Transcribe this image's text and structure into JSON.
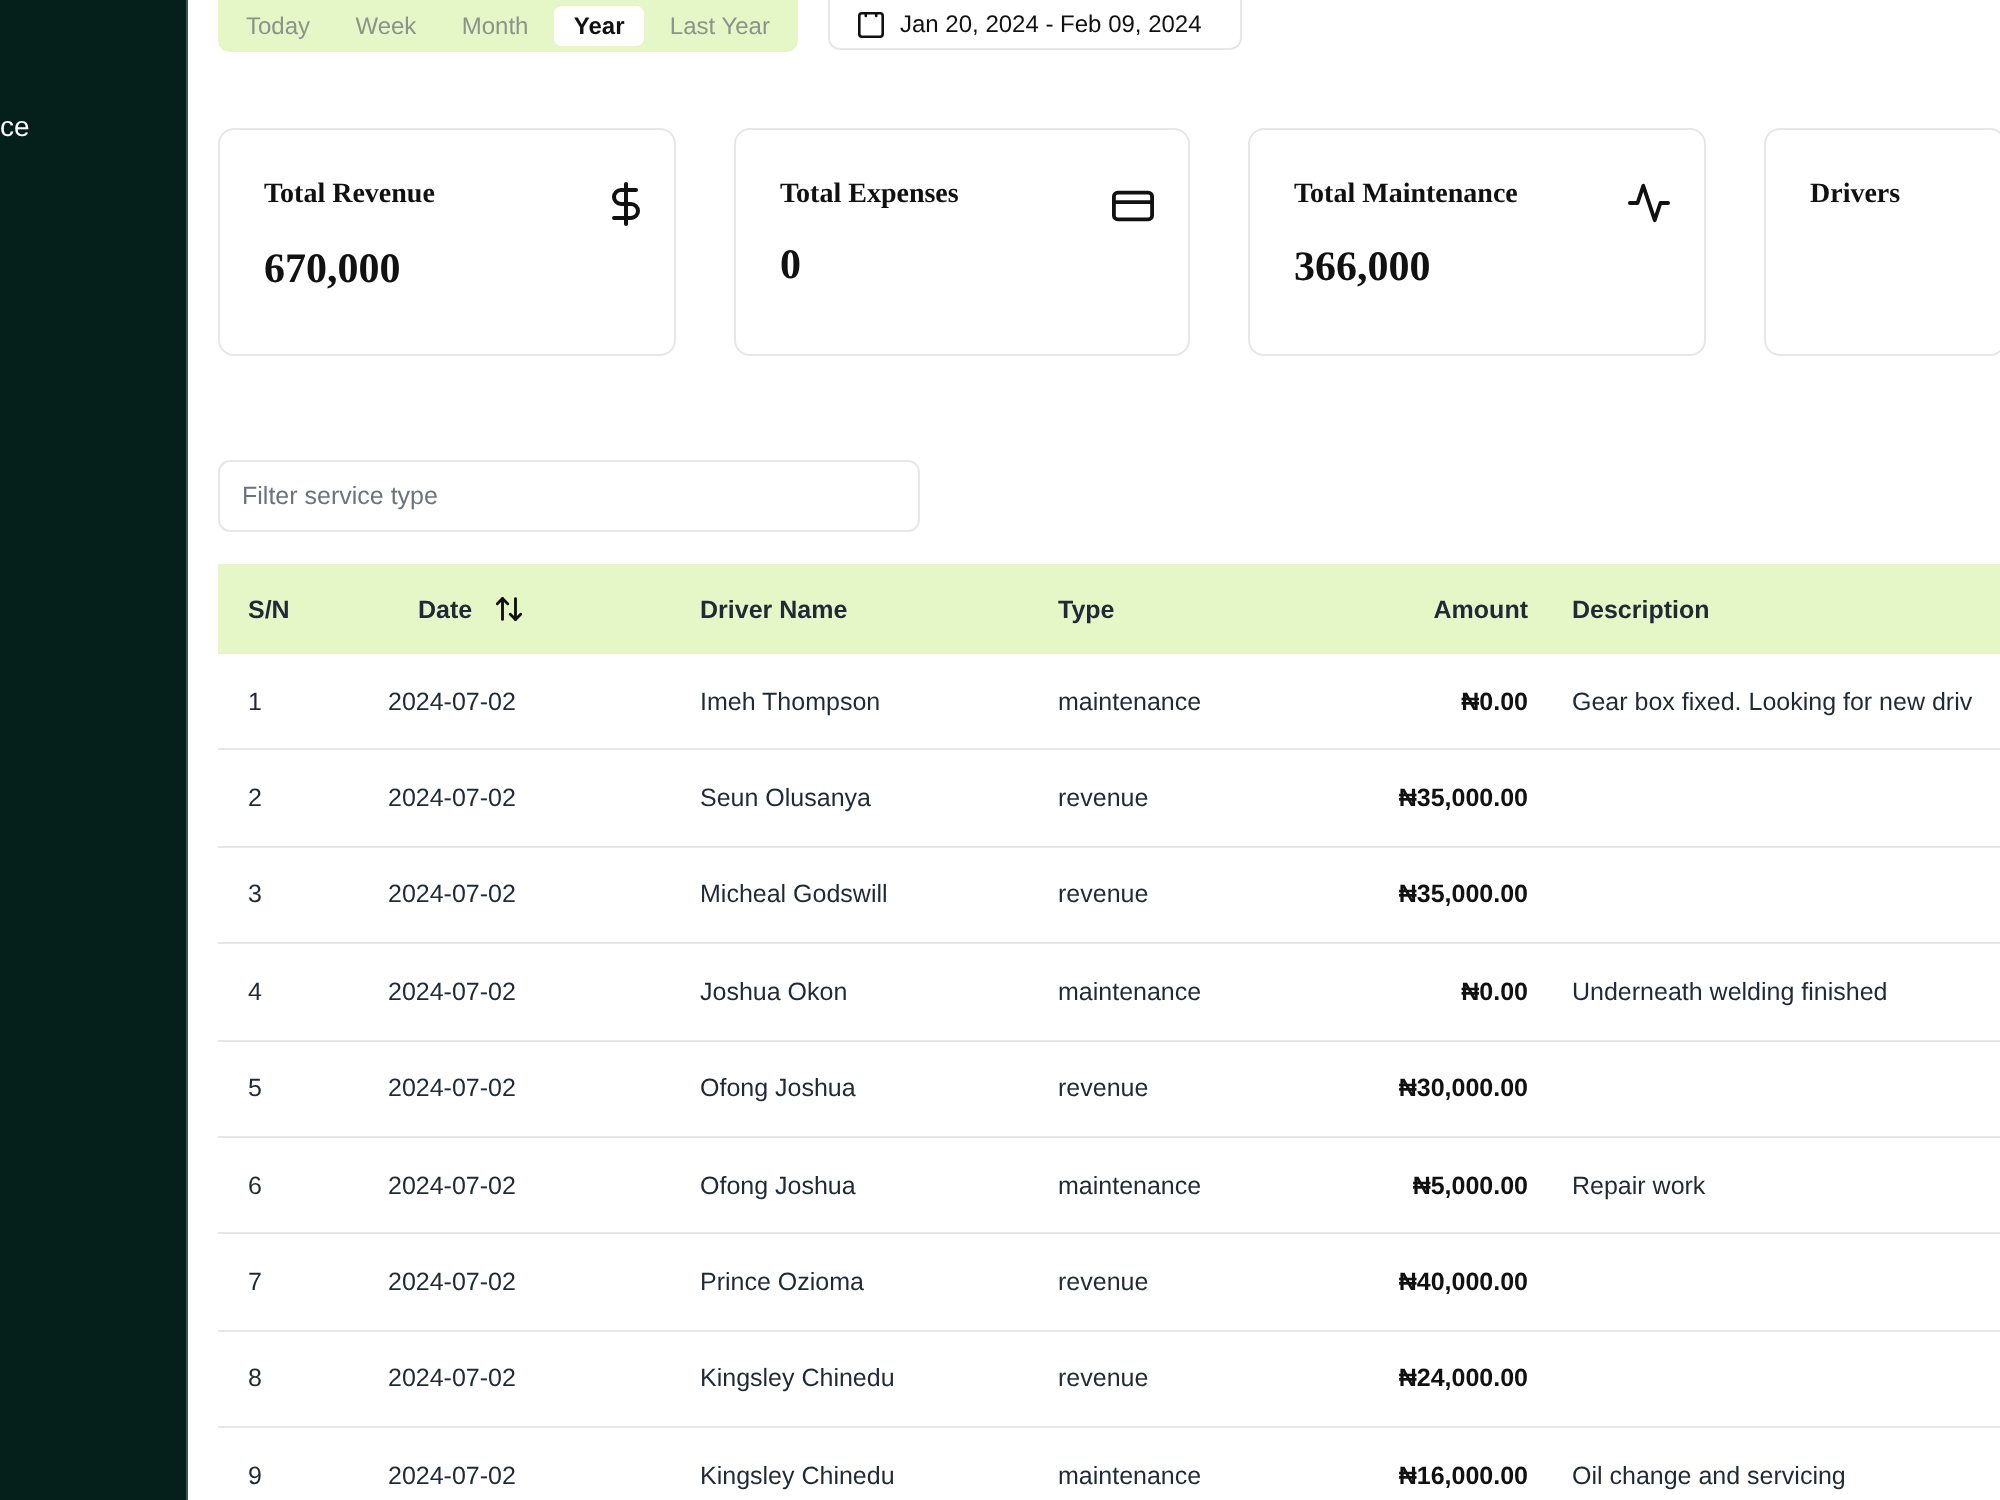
{
  "sidebar": {
    "items": [
      {
        "label": "ce"
      }
    ]
  },
  "toolbar": {
    "tabs": [
      {
        "label": "Today",
        "selected": false
      },
      {
        "label": "Week",
        "selected": false
      },
      {
        "label": "Month",
        "selected": false
      },
      {
        "label": "Year",
        "selected": true
      },
      {
        "label": "Last Year",
        "selected": false
      }
    ],
    "date_range": {
      "value": "Jan 20, 2024 - Feb 09, 2024"
    }
  },
  "stat_cards": [
    {
      "kind": "revenue",
      "title": "Total Revenue",
      "value": "670,000"
    },
    {
      "kind": "expenses",
      "title": "Total Expenses",
      "value": "0"
    },
    {
      "kind": "maintenance",
      "title": "Total Maintenance",
      "value": "366,000"
    },
    {
      "kind": "drivers",
      "title": "Drivers"
    }
  ],
  "filter": {
    "placeholder": "Filter service type"
  },
  "table": {
    "columns": [
      {
        "label": "S/N",
        "sortable": false
      },
      {
        "label": "Date",
        "sortable": true
      },
      {
        "label": "Driver Name",
        "sortable": false
      },
      {
        "label": "Type",
        "sortable": false
      },
      {
        "label": "Amount",
        "sortable": false
      },
      {
        "label": "Description",
        "sortable": false
      }
    ],
    "rows": [
      {
        "sn": "1",
        "date": "2024-07-02",
        "driver_name": "Imeh Thompson",
        "type": "maintenance",
        "amount": "₦0.00",
        "description": "Gear box fixed. Looking for new driv"
      },
      {
        "sn": "2",
        "date": "2024-07-02",
        "driver_name": "Seun Olusanya",
        "type": "revenue",
        "amount": "₦35,000.00"
      },
      {
        "sn": "3",
        "date": "2024-07-02",
        "driver_name": "Micheal Godswill",
        "type": "revenue",
        "amount": "₦35,000.00"
      },
      {
        "sn": "4",
        "date": "2024-07-02",
        "driver_name": "Joshua Okon",
        "type": "maintenance",
        "amount": "₦0.00",
        "description": "Underneath welding finished"
      },
      {
        "sn": "5",
        "date": "2024-07-02",
        "driver_name": "Ofong Joshua",
        "type": "revenue",
        "amount": "₦30,000.00"
      },
      {
        "sn": "6",
        "date": "2024-07-02",
        "driver_name": "Ofong Joshua",
        "type": "maintenance",
        "amount": "₦5,000.00",
        "description": "Repair work"
      },
      {
        "sn": "7",
        "date": "2024-07-02",
        "driver_name": "Prince Ozioma",
        "type": "revenue",
        "amount": "₦40,000.00"
      },
      {
        "sn": "8",
        "date": "2024-07-02",
        "driver_name": "Kingsley Chinedu",
        "type": "revenue",
        "amount": "₦24,000.00"
      },
      {
        "sn": "9",
        "date": "2024-07-02",
        "driver_name": "Kingsley Chinedu",
        "type": "maintenance",
        "amount": "₦16,000.00",
        "description": "Oil change and servicing"
      }
    ]
  }
}
